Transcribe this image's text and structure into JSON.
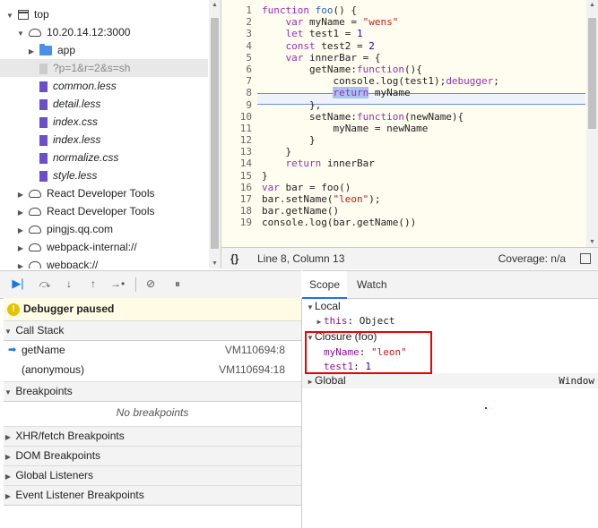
{
  "tree": {
    "items": [
      {
        "label": "top",
        "icon": "page-icon",
        "indent": 0,
        "tri": "▼"
      },
      {
        "label": "10.20.14.12:3000",
        "icon": "cloud-icon",
        "indent": 1,
        "tri": "▼"
      },
      {
        "label": "app",
        "icon": "folder-icon",
        "indent": 2,
        "tri": "▶"
      },
      {
        "label": "?p=1&r=2&s=sh",
        "icon": "file-icon",
        "indent": 2,
        "tri": "",
        "selected": true
      },
      {
        "label": "common.less",
        "icon": "file-icon",
        "indent": 2,
        "tri": "",
        "italic": true
      },
      {
        "label": "detail.less",
        "icon": "file-icon",
        "indent": 2,
        "tri": "",
        "italic": true
      },
      {
        "label": "index.css",
        "icon": "file-icon",
        "indent": 2,
        "tri": "",
        "italic": true
      },
      {
        "label": "index.less",
        "icon": "file-icon",
        "indent": 2,
        "tri": "",
        "italic": true
      },
      {
        "label": "normalize.css",
        "icon": "file-icon",
        "indent": 2,
        "tri": "",
        "italic": true
      },
      {
        "label": "style.less",
        "icon": "file-icon",
        "indent": 2,
        "tri": "",
        "italic": true
      },
      {
        "label": "React Developer Tools",
        "icon": "cloud-icon",
        "indent": 1,
        "tri": "▶"
      },
      {
        "label": "React Developer Tools",
        "icon": "cloud-icon",
        "indent": 1,
        "tri": "▶"
      },
      {
        "label": "pingjs.qq.com",
        "icon": "cloud-icon",
        "indent": 1,
        "tri": "▶"
      },
      {
        "label": "webpack-internal://",
        "icon": "cloud-icon",
        "indent": 1,
        "tri": "▶"
      },
      {
        "label": "webpack://",
        "icon": "cloud-icon",
        "indent": 1,
        "tri": "▶"
      }
    ]
  },
  "editor": {
    "line_numbers": [
      "1",
      "2",
      "3",
      "4",
      "5",
      "6",
      "7",
      "8",
      "9",
      "10",
      "11",
      "12",
      "13",
      "14",
      "15",
      "16",
      "17",
      "18",
      "19"
    ],
    "status_left": "{}",
    "position": "Line 8, Column 13",
    "coverage": "Coverage: n/a"
  },
  "toolbar": {
    "resume": "resume-icon",
    "step_over": "step-over-icon",
    "step_into": "step-into-icon",
    "step_out": "step-out-icon",
    "step": "step-icon",
    "deactivate": "deactivate-breakpoints-icon",
    "pause_exceptions": "pause-on-exceptions-icon"
  },
  "debugger": {
    "paused_label": "Debugger paused",
    "call_stack_label": "Call Stack",
    "frames": [
      {
        "name": "getName",
        "loc": "VM110694:8"
      },
      {
        "name": "(anonymous)",
        "loc": "VM110694:18"
      }
    ],
    "breakpoints_label": "Breakpoints",
    "no_breakpoints": "No breakpoints",
    "xhr_label": "XHR/fetch Breakpoints",
    "dom_label": "DOM Breakpoints",
    "global_label": "Global Listeners",
    "event_label": "Event Listener Breakpoints"
  },
  "scope": {
    "tab_scope": "Scope",
    "tab_watch": "Watch",
    "local_label": "Local",
    "this_key": "this",
    "this_val": "Object",
    "closure_label": "Closure (foo)",
    "myname_key": "myName",
    "myname_val": "\"leon\"",
    "test1_key": "test1",
    "test1_val": "1",
    "global_label": "Global",
    "global_val": "Window"
  },
  "colors": {
    "highlight_box": "#e00000",
    "accent": "#1a73e8",
    "file": "#6a4fc8",
    "folder": "#4a8fe8"
  }
}
